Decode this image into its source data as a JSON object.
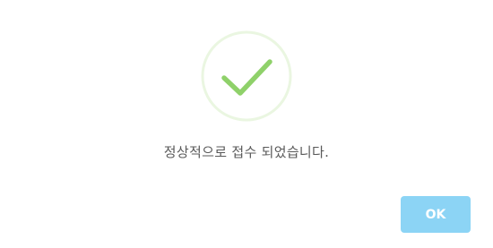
{
  "dialog": {
    "message": "정상적으로 접수 되었습니다.",
    "ok_label": "OK",
    "icon": "success-check-icon"
  },
  "colors": {
    "check": "#8fd16a",
    "check_ring": "#eaf6e1",
    "message_text": "#595959",
    "ok_button_bg": "#8cd4f5",
    "ok_button_text": "#ffffff"
  }
}
